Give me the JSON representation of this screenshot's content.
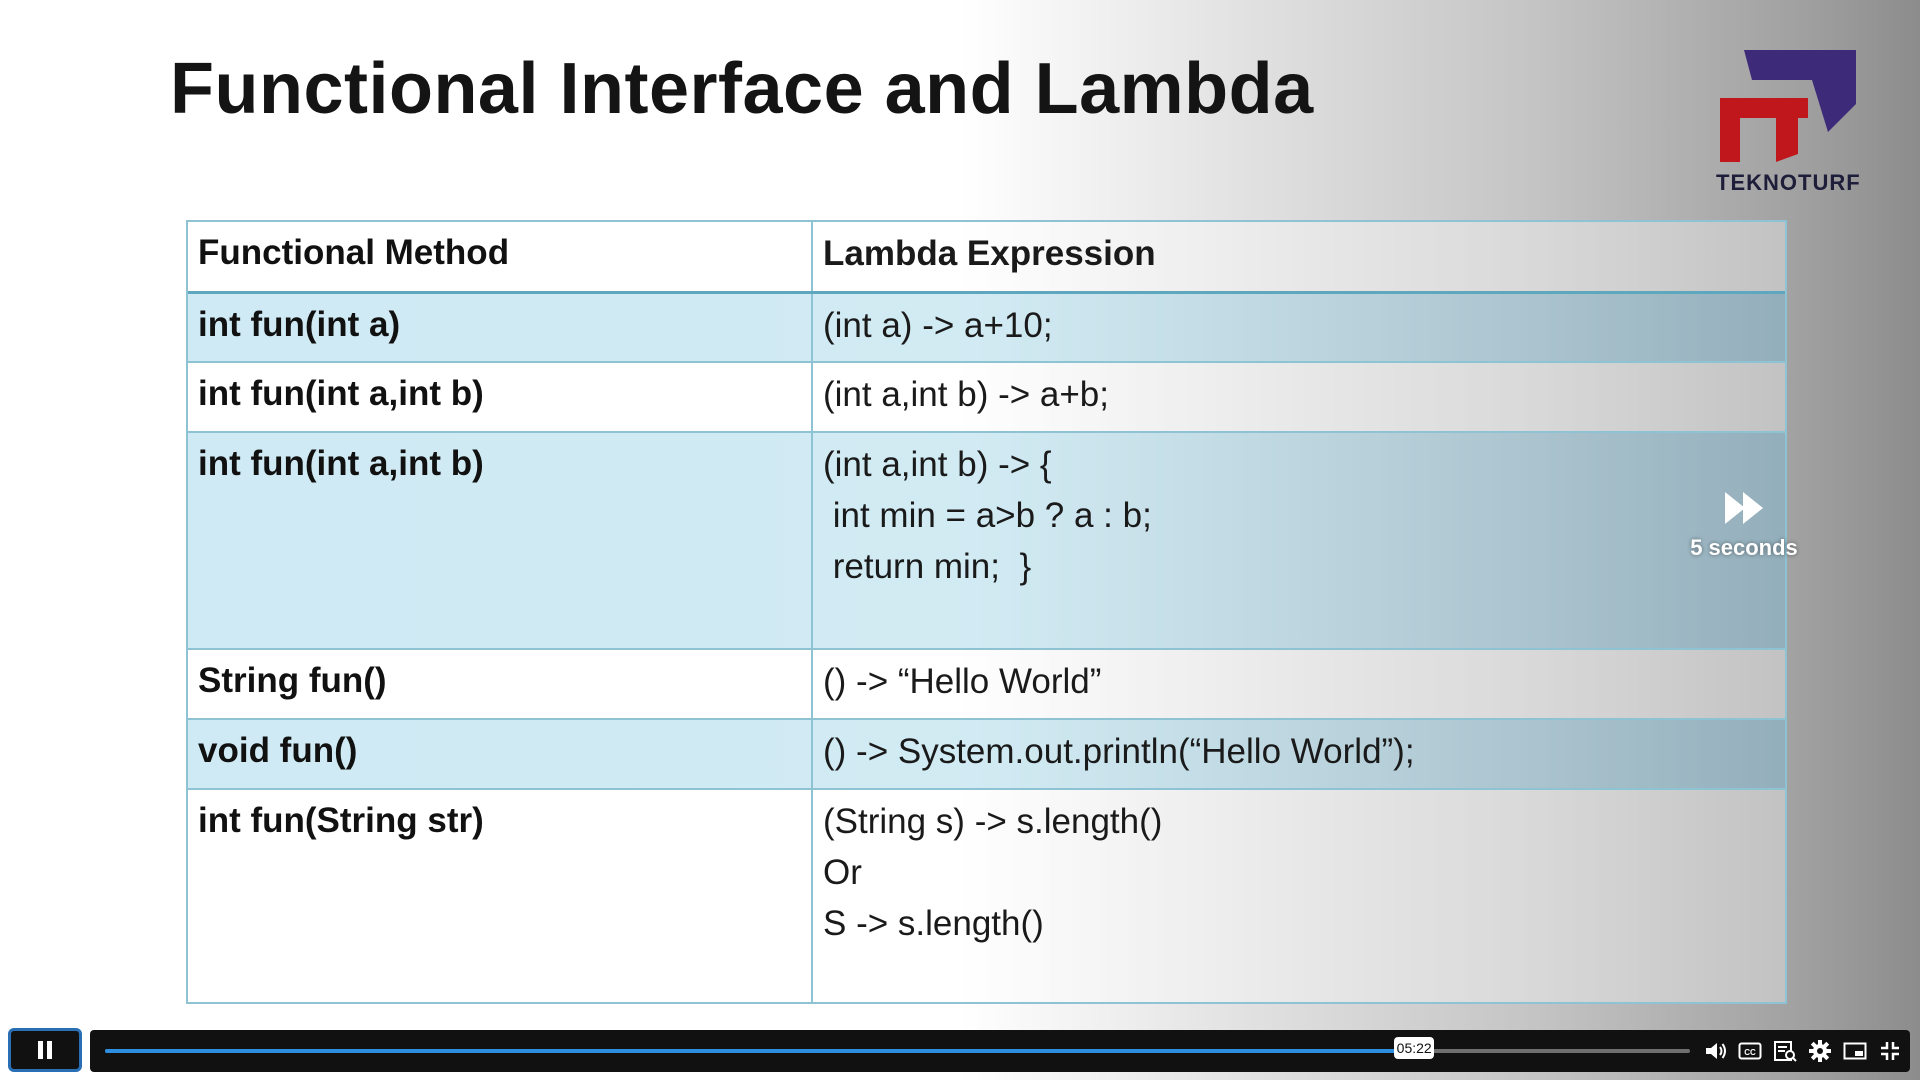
{
  "slide": {
    "title": "Functional Interface and Lambda",
    "logo_text": "TEKNOTURF",
    "table": {
      "headers": [
        "Functional Method",
        "Lambda Expression"
      ],
      "rows": [
        {
          "method": "int fun(int a)",
          "lambda": [
            "(int a) -> a+10;"
          ]
        },
        {
          "method": "int fun(int a,int b)",
          "lambda": [
            "(int a,int b) -> a+b;"
          ]
        },
        {
          "method": "int fun(int a,int b)",
          "lambda": [
            "(int a,int b) -> {",
            " int min = a>b ? a : b;",
            " return min;  }"
          ]
        },
        {
          "method": "String fun()",
          "lambda": [
            "() -> “Hello World”"
          ]
        },
        {
          "method": "void fun()",
          "lambda": [
            "() -> System.out.println(“Hello World”);"
          ]
        },
        {
          "method": "int fun(String str)",
          "lambda": [
            "(String s) -> s.length()",
            "Or",
            "S -> s.length()"
          ]
        }
      ]
    }
  },
  "player": {
    "skip_label": "5 seconds",
    "skip_icon": "fast-forward-icon",
    "current_time": "05:22",
    "progress_fraction": 0.826,
    "buttons": [
      "pause-icon",
      "volume-icon",
      "captions-icon",
      "transcript-icon",
      "settings-icon",
      "picture-in-picture-icon",
      "exit-fullscreen-icon"
    ],
    "colors": {
      "progress": "#2c8fe0",
      "focus_ring": "#2a6fb3",
      "logo_red": "#c0171c",
      "logo_purple": "#3d2b7a"
    }
  }
}
